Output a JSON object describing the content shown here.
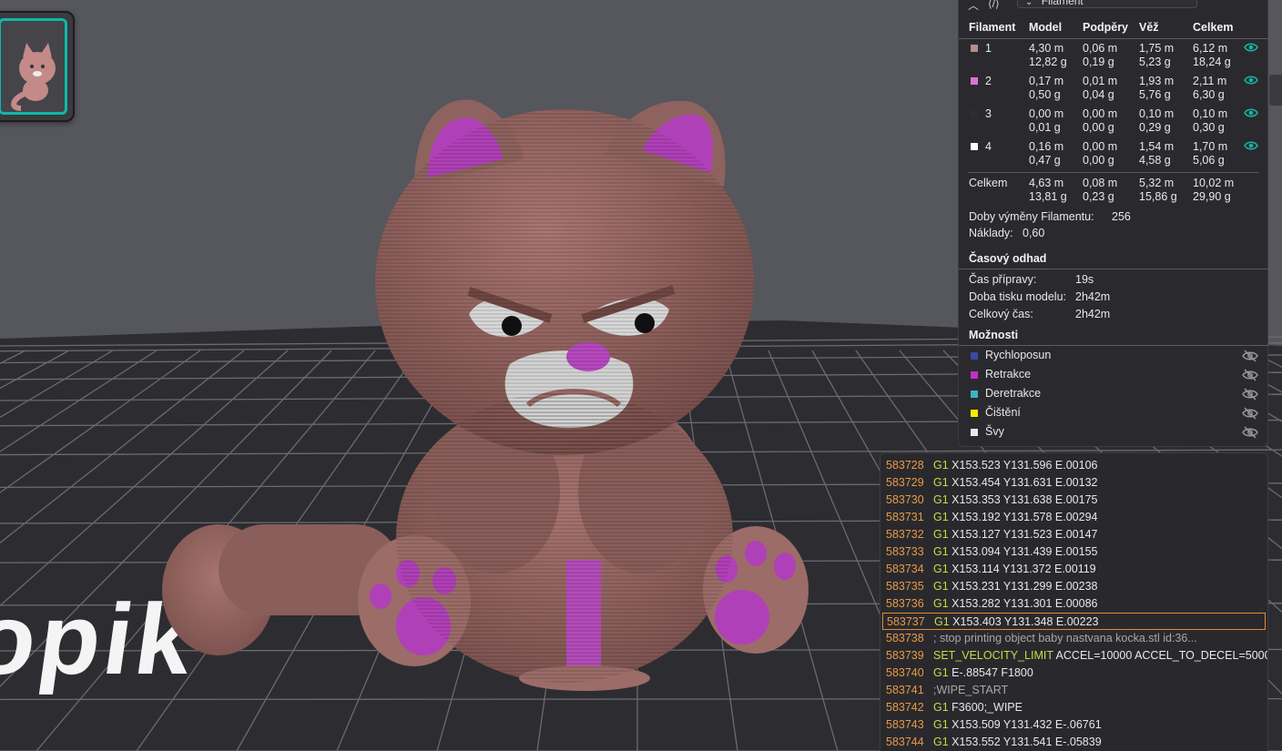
{
  "toolbar": {
    "view_select": "Filament"
  },
  "filament_table": {
    "headers": [
      "Filament",
      "Model",
      "Podpěry",
      "Věž",
      "Celkem"
    ],
    "rows": [
      {
        "id": "1",
        "color": "#b88c8c",
        "model": [
          "4,30 m",
          "12,82 g"
        ],
        "supports": [
          "0,06 m",
          "0,19 g"
        ],
        "tower": [
          "1,75 m",
          "5,23 g"
        ],
        "total": [
          "6,12 m",
          "18,24 g"
        ]
      },
      {
        "id": "2",
        "color": "#e070e0",
        "model": [
          "0,17 m",
          "0,50 g"
        ],
        "supports": [
          "0,01 m",
          "0,04 g"
        ],
        "tower": [
          "1,93 m",
          "5,76 g"
        ],
        "total": [
          "2,11 m",
          "6,30 g"
        ]
      },
      {
        "id": "3",
        "color": "#2e2e2e",
        "model": [
          "0,00 m",
          "0,01 g"
        ],
        "supports": [
          "0,00 m",
          "0,00 g"
        ],
        "tower": [
          "0,10 m",
          "0,29 g"
        ],
        "total": [
          "0,10 m",
          "0,30 g"
        ]
      },
      {
        "id": "4",
        "color": "#ffffff",
        "model": [
          "0,16 m",
          "0,47 g"
        ],
        "supports": [
          "0,00 m",
          "0,00 g"
        ],
        "tower": [
          "1,54 m",
          "4,58 g"
        ],
        "total": [
          "1,70 m",
          "5,06 g"
        ]
      }
    ],
    "summary": {
      "label": "Celkem",
      "model": [
        "4,63 m",
        "13,81 g"
      ],
      "supports": [
        "0,08 m",
        "0,23 g"
      ],
      "tower": [
        "5,32 m",
        "15,86 g"
      ],
      "total": [
        "10,02 m",
        "29,90 g"
      ]
    },
    "changes_label": "Doby výměny Filamentu:",
    "changes_value": "256",
    "cost_label": "Náklady:",
    "cost_value": "0,60"
  },
  "time_estimate": {
    "title": "Časový odhad",
    "prep_label": "Čas přípravy:",
    "prep_value": "19s",
    "model_label": "Doba tisku modelu:",
    "model_value": "2h42m",
    "total_label": "Celkový čas:",
    "total_value": "2h42m"
  },
  "options": {
    "title": "Možnosti",
    "items": [
      {
        "label": "Rychloposun",
        "color": "#3a4aa0"
      },
      {
        "label": "Retrakce",
        "color": "#c030c8"
      },
      {
        "label": "Deretrakce",
        "color": "#40b0c8"
      },
      {
        "label": "Čištění",
        "color": "#f0f000"
      },
      {
        "label": "Švy",
        "color": "#e8e8e8"
      }
    ]
  },
  "gcode": [
    {
      "num": "583728",
      "cmd": "G1",
      "args": " X153.523 Y131.596 E.00106"
    },
    {
      "num": "583729",
      "cmd": "G1",
      "args": " X153.454 Y131.631 E.00132"
    },
    {
      "num": "583730",
      "cmd": "G1",
      "args": " X153.353 Y131.638 E.00175"
    },
    {
      "num": "583731",
      "cmd": "G1",
      "args": " X153.192 Y131.578 E.00294"
    },
    {
      "num": "583732",
      "cmd": "G1",
      "args": " X153.127 Y131.523 E.00147"
    },
    {
      "num": "583733",
      "cmd": "G1",
      "args": " X153.094 Y131.439 E.00155"
    },
    {
      "num": "583734",
      "cmd": "G1",
      "args": " X153.114 Y131.372 E.00119"
    },
    {
      "num": "583735",
      "cmd": "G1",
      "args": " X153.231 Y131.299 E.00238"
    },
    {
      "num": "583736",
      "cmd": "G1",
      "args": " X153.282 Y131.301 E.00086"
    },
    {
      "num": "583737",
      "cmd": "G1",
      "args": " X153.403 Y131.348 E.00223",
      "selected": true
    },
    {
      "num": "583738",
      "comment": "; stop printing object baby nastvana kocka.stl id:36..."
    },
    {
      "num": "583739",
      "cmd": "SET_VELOCITY_LIMIT",
      "args": " ACCEL=10000 ACCEL_TO_DECEL=5000"
    },
    {
      "num": "583740",
      "cmd": "G1",
      "args": " E-.88547 F1800"
    },
    {
      "num": "583741",
      "comment": ";WIPE_START"
    },
    {
      "num": "583742",
      "cmd": "G1",
      "args": " F3600;_WIPE"
    },
    {
      "num": "583743",
      "cmd": "G1",
      "args": " X153.509 Y131.432 E-.06761"
    },
    {
      "num": "583744",
      "cmd": "G1",
      "args": " X153.552 Y131.541 E-.05839"
    }
  ],
  "colors": {
    "accent": "#10b8a8",
    "plate": "#2c2c2f",
    "model": "#9c6c68",
    "highlight": "#b840b8"
  },
  "icons": [
    "eye-icon",
    "eye-off-icon",
    "collapse-icon",
    "code-icon",
    "chevron-down-icon"
  ]
}
